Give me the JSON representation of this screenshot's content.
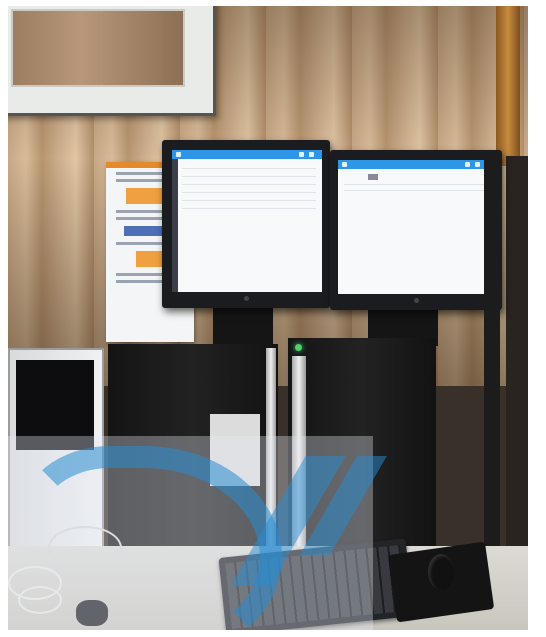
{
  "scene": {
    "subject": "dual-monitor-workstation",
    "monitor_left_screen_color": "#f7f9fb",
    "monitor_right_screen_color": "#f7f9fb",
    "app_titlebar_color": "#2e96e6",
    "power_led_color": "#4cd06a",
    "curtain_color": "#c9a886",
    "watermark_color": "#288cd2"
  }
}
